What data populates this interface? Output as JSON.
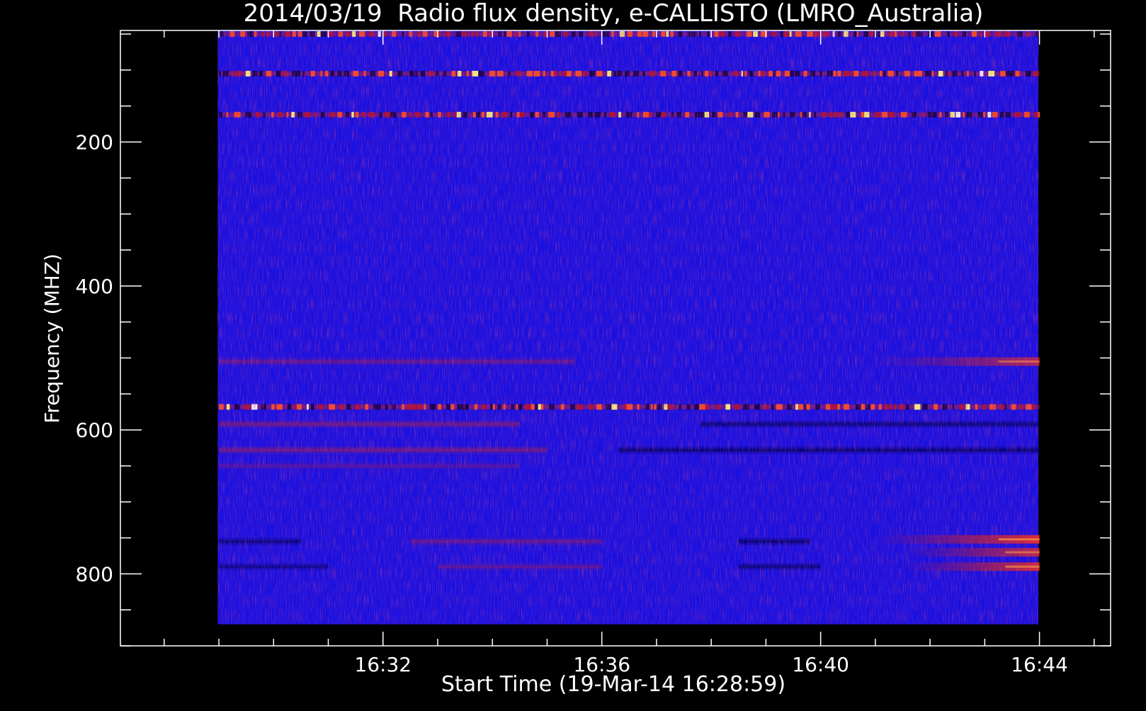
{
  "chart_data": {
    "type": "heatmap",
    "title": "2014/03/19  Radio flux density, e-CALLISTO (LMRO_Australia)",
    "xlabel": "Start Time (19-Mar-14 16:28:59)",
    "ylabel": "Frequency (MHZ)",
    "x_ticks": [
      {
        "value": 32,
        "label": "16:32"
      },
      {
        "value": 36,
        "label": "16:36"
      },
      {
        "value": 40,
        "label": "16:40"
      },
      {
        "value": 44,
        "label": "16:44"
      }
    ],
    "x_minor_every_min": 1,
    "xlim_minutes_after_1600": [
      27.2,
      45.3
    ],
    "data_extent_minutes": [
      28.98,
      43.98
    ],
    "y_ticks": [
      {
        "value": 200,
        "label": "200"
      },
      {
        "value": 400,
        "label": "400"
      },
      {
        "value": 600,
        "label": "600"
      },
      {
        "value": 800,
        "label": "800"
      }
    ],
    "y_minor_every_mhz": 50,
    "ylim_mhz": [
      45,
      900
    ],
    "data_extent_mhz": [
      45,
      870
    ],
    "y_inverted": true,
    "colormap": {
      "low": "#000060",
      "background": "#1a10e0",
      "mid": "#d02020",
      "high": "#ffffff"
    },
    "bands": [
      {
        "freq_mhz": 50,
        "start_min": 29.0,
        "end_min": 44.0,
        "intensity": 0.7,
        "kind": "dashed"
      },
      {
        "freq_mhz": 105,
        "start_min": 29.0,
        "end_min": 44.0,
        "intensity": 0.8,
        "kind": "dashed"
      },
      {
        "freq_mhz": 162,
        "start_min": 29.0,
        "end_min": 44.0,
        "intensity": 0.75,
        "kind": "dashed"
      },
      {
        "freq_mhz": 505,
        "start_min": 29.0,
        "end_min": 35.5,
        "intensity": 0.3,
        "kind": "smooth"
      },
      {
        "freq_mhz": 505,
        "start_min": 41.0,
        "end_min": 44.0,
        "intensity": 0.65,
        "kind": "ramp"
      },
      {
        "freq_mhz": 568,
        "start_min": 29.0,
        "end_min": 44.0,
        "intensity": 0.85,
        "kind": "dashed"
      },
      {
        "freq_mhz": 592,
        "start_min": 29.0,
        "end_min": 34.5,
        "intensity": 0.35,
        "kind": "smooth"
      },
      {
        "freq_mhz": 592,
        "start_min": 37.8,
        "end_min": 44.0,
        "intensity": -0.6,
        "kind": "smooth"
      },
      {
        "freq_mhz": 628,
        "start_min": 29.0,
        "end_min": 35.0,
        "intensity": 0.35,
        "kind": "smooth"
      },
      {
        "freq_mhz": 628,
        "start_min": 36.3,
        "end_min": 44.0,
        "intensity": -0.7,
        "kind": "smooth"
      },
      {
        "freq_mhz": 650,
        "start_min": 29.0,
        "end_min": 34.5,
        "intensity": 0.2,
        "kind": "smooth"
      },
      {
        "freq_mhz": 755,
        "start_min": 29.0,
        "end_min": 30.5,
        "intensity": -0.6,
        "kind": "smooth"
      },
      {
        "freq_mhz": 755,
        "start_min": 32.5,
        "end_min": 36.0,
        "intensity": 0.3,
        "kind": "smooth"
      },
      {
        "freq_mhz": 755,
        "start_min": 38.5,
        "end_min": 39.8,
        "intensity": -0.7,
        "kind": "smooth"
      },
      {
        "freq_mhz": 752,
        "start_min": 41.0,
        "end_min": 44.0,
        "intensity": 0.85,
        "kind": "ramp"
      },
      {
        "freq_mhz": 770,
        "start_min": 41.5,
        "end_min": 44.0,
        "intensity": 0.7,
        "kind": "ramp"
      },
      {
        "freq_mhz": 790,
        "start_min": 29.0,
        "end_min": 31.0,
        "intensity": -0.5,
        "kind": "smooth"
      },
      {
        "freq_mhz": 790,
        "start_min": 33.0,
        "end_min": 36.0,
        "intensity": 0.25,
        "kind": "smooth"
      },
      {
        "freq_mhz": 790,
        "start_min": 38.5,
        "end_min": 40.0,
        "intensity": -0.6,
        "kind": "smooth"
      },
      {
        "freq_mhz": 790,
        "start_min": 41.5,
        "end_min": 44.0,
        "intensity": 0.8,
        "kind": "ramp"
      }
    ]
  }
}
